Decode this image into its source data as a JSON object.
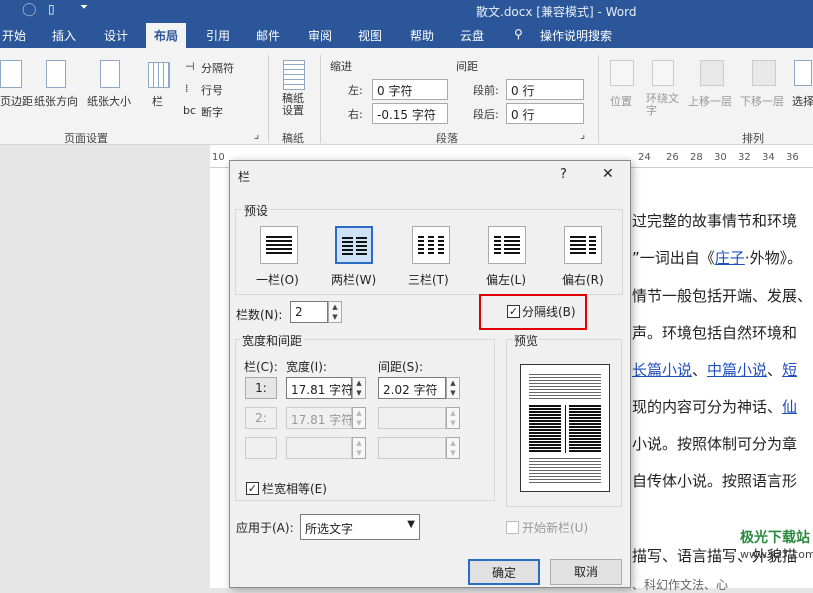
{
  "titlebar": {
    "title": "散文.docx [兼容模式] - Word"
  },
  "tabs": [
    "开始",
    "插入",
    "设计",
    "布局",
    "引用",
    "邮件",
    "审阅",
    "视图",
    "帮助",
    "云盘"
  ],
  "tell_me": "操作说明搜索",
  "ribbon": {
    "margins": "页边距",
    "orientation": "纸张方向",
    "size": "纸张大小",
    "columns": "栏",
    "breaks": "分隔符",
    "line_numbers": "行号",
    "hyphenation": "断字",
    "group_page_setup": "页面设置",
    "draft_paper": "稿纸\n设置",
    "group_draft": "稿纸",
    "indent_title": "缩进",
    "spacing_title": "间距",
    "indent_left_label": "左:",
    "indent_left_value": "0 字符",
    "indent_right_label": "右:",
    "indent_right_value": "-0.15 字符",
    "space_before_label": "段前:",
    "space_before_value": "0 行",
    "space_after_label": "段后:",
    "space_after_value": "0 行",
    "group_paragraph": "段落",
    "position": "位置",
    "wrap_text": "环绕文\n字",
    "bring_forward": "上移一层",
    "send_backward": "下移一层",
    "selection": "选择",
    "group_arrange": "排列"
  },
  "ruler_numbers": [
    "10",
    "24",
    "26",
    "28",
    "30",
    "32",
    "34",
    "36"
  ],
  "document_lines": [
    "过完整的故事情节和环境",
    "”一词出自《庄子·外物》。",
    "情节一般包括开端、发展、",
    "声。环境包括自然环境和",
    "长篇小说、中篇小说、短",
    "现的内容可分为神话、仙",
    "小说。按照体制可分为章",
    "自传体小说。按照语言形",
    "",
    "描写、语言描写、外貌描",
    "、科幻作文法、心"
  ],
  "watermark": "极光下载站\nwww.xz7.com",
  "dialog": {
    "title": "栏",
    "help": "?",
    "close": "✕",
    "presets_title": "预设",
    "presets": [
      "一栏(O)",
      "两栏(W)",
      "三栏(T)",
      "偏左(L)",
      "偏右(R)"
    ],
    "num_cols_label": "栏数(N):",
    "num_cols_value": "2",
    "separator_label": "分隔线(B)",
    "width_spacing_title": "宽度和间距",
    "col_header": "栏(C):",
    "width_header": "宽度(I):",
    "spacing_header": "间距(S):",
    "rows": [
      {
        "col": "1:",
        "width": "17.81 字符",
        "spacing": "2.02 字符"
      },
      {
        "col": "2:",
        "width": "17.81 字符",
        "spacing": ""
      },
      {
        "col": "",
        "width": "",
        "spacing": ""
      }
    ],
    "equal_width_label": "栏宽相等(E)",
    "preview_title": "预览",
    "apply_to_label": "应用于(A):",
    "apply_to_value": "所选文字",
    "new_column_label": "开始新栏(U)",
    "ok": "确定",
    "cancel": "取消"
  },
  "colors": {
    "accent": "#2b579a",
    "highlight_box": "#e00000"
  }
}
